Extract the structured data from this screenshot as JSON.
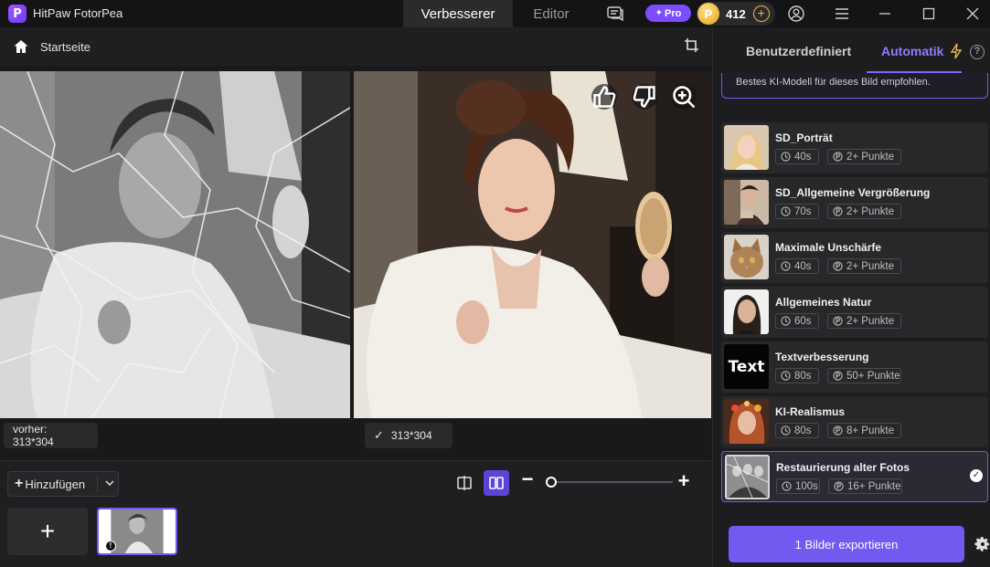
{
  "titlebar": {
    "app_title": "HitPaw FotorPea",
    "tabs": [
      {
        "label": "Verbesserer",
        "active": true
      },
      {
        "label": "Editor",
        "active": false
      }
    ],
    "pro_label": "Pro",
    "coins": "412"
  },
  "subheader": {
    "breadcrumb": "Startseite"
  },
  "preview": {
    "before_label": "vorher: 313*304",
    "after_label": "313*304"
  },
  "toolbar": {
    "add_label": "Hinzufügen"
  },
  "panel": {
    "tab_custom": "Benutzerdefiniert",
    "tab_auto": "Automatik",
    "hint": "Bestes KI-Modell für dieses Bild empfohlen.",
    "models": [
      {
        "name": "SD_Porträt",
        "time": "40s",
        "points": "2+ Punkte"
      },
      {
        "name": "SD_Allgemeine Vergrößerung",
        "time": "70s",
        "points": "2+ Punkte"
      },
      {
        "name": "Maximale Unschärfe",
        "time": "40s",
        "points": "2+ Punkte"
      },
      {
        "name": "Allgemeines Natur",
        "time": "60s",
        "points": "2+ Punkte"
      },
      {
        "name": "Textverbesserung",
        "time": "80s",
        "points": "50+ Punkte",
        "thumb_text": "Text"
      },
      {
        "name": "KI-Realismus",
        "time": "80s",
        "points": "8+ Punkte"
      },
      {
        "name": "Restaurierung alter Fotos",
        "time": "100s",
        "points": "16+ Punkte",
        "selected": true
      }
    ],
    "export_label": "1 Bilder exportieren"
  },
  "colors": {
    "accent": "#7259f0",
    "accent_text": "#8f7dff",
    "coin": "#e6a41a"
  }
}
